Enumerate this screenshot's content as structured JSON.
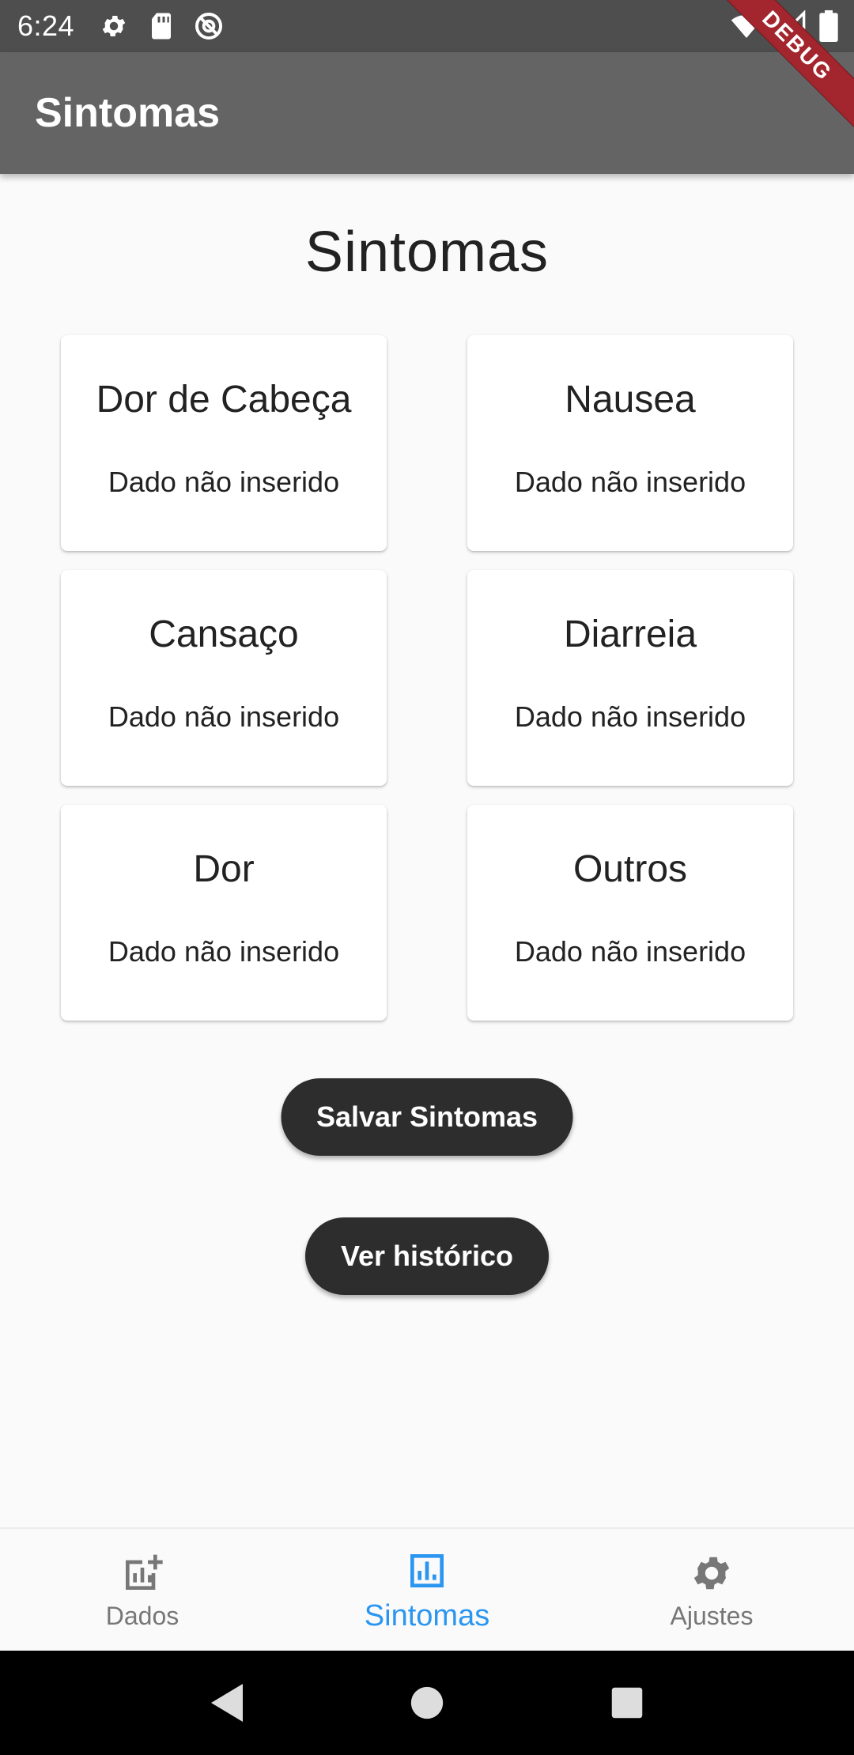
{
  "status_bar": {
    "time": "6:24",
    "left_icons": [
      "gear-icon",
      "sd-card-icon",
      "at-sign-icon"
    ],
    "right_icons": [
      "wifi-icon",
      "signal-icon",
      "battery-icon"
    ]
  },
  "debug_banner": "DEBUG",
  "app_bar": {
    "title": "Sintomas"
  },
  "main": {
    "heading": "Sintomas",
    "cards": [
      {
        "title": "Dor de Cabeça",
        "status": "Dado não inserido"
      },
      {
        "title": "Nausea",
        "status": "Dado não inserido"
      },
      {
        "title": "Cansaço",
        "status": "Dado não inserido"
      },
      {
        "title": "Diarreia",
        "status": "Dado não inserido"
      },
      {
        "title": "Dor",
        "status": "Dado não inserido"
      },
      {
        "title": "Outros",
        "status": "Dado não inserido"
      }
    ],
    "save_button": "Salvar Sintomas",
    "history_button": "Ver histórico"
  },
  "bottom_nav": {
    "active_color": "#2a96f0",
    "inactive_color": "#777777",
    "items": [
      {
        "label": "Dados",
        "icon": "add-chart-icon",
        "active": false
      },
      {
        "label": "Sintomas",
        "icon": "bar-chart-icon",
        "active": true
      },
      {
        "label": "Ajustes",
        "icon": "gear-icon",
        "active": false
      }
    ]
  },
  "system_nav": {
    "icons": [
      "back-icon",
      "home-icon",
      "recents-icon"
    ]
  },
  "colors": {
    "status_bar": "#4e4e4e",
    "app_bar": "#646464",
    "button": "#2d2d2d",
    "debug_ribbon": "#a3252d"
  }
}
